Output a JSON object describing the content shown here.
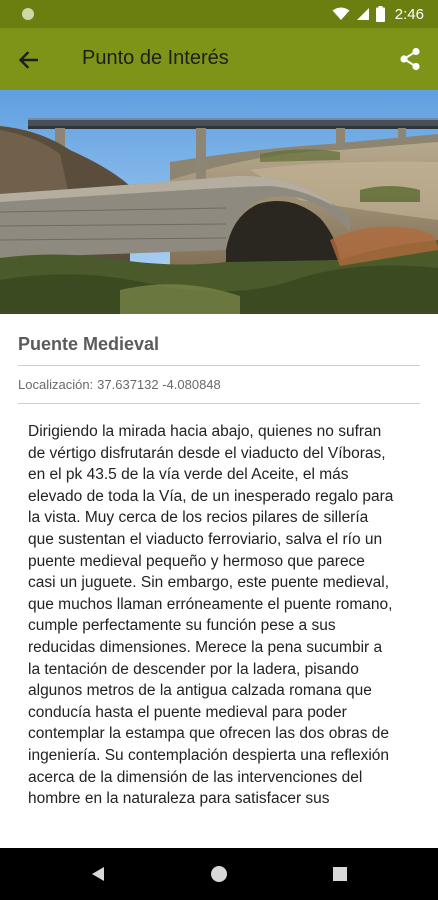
{
  "status_bar": {
    "time": "2:46"
  },
  "app_bar": {
    "title": "Punto de Interés"
  },
  "poi": {
    "name": "Puente Medieval",
    "location_label": "Localización:",
    "location_coords": "37.637132 -4.080848",
    "description": "Dirigiendo la mirada hacia abajo, quienes no sufran de vértigo disfrutarán desde el viaducto del Víboras, en el pk 43.5 de la vía verde del Aceite, el más elevado de toda la Vía, de un inesperado regalo para la vista. Muy cerca de los recios pilares de sillería que sustentan el viaducto ferroviario, salva el río un puente medieval pequeño y hermoso que parece casi un juguete. Sin embargo, este puente medieval, que muchos llaman erróneamente el puente romano, cumple perfectamente su función pese a sus reducidas dimensiones. Merece la pena sucumbir a la tentación de descender por la ladera, pisando algunos metros de la antigua calzada romana que conducía hasta el puente medieval para poder contemplar la estampa que ofrecen las dos obras de ingeniería. Su contemplación despierta una reflexión acerca de la dimensión de las intervenciones del hombre en la naturaleza para satisfacer sus"
  },
  "colors": {
    "status_bar": "#6a7f0f",
    "app_bar": "#7e9418",
    "nav_bar": "#000000"
  },
  "icons": [
    "wifi-icon",
    "signal-icon",
    "battery-icon",
    "back-arrow-icon",
    "share-icon",
    "nav-back-icon",
    "nav-home-icon",
    "nav-recents-icon"
  ]
}
